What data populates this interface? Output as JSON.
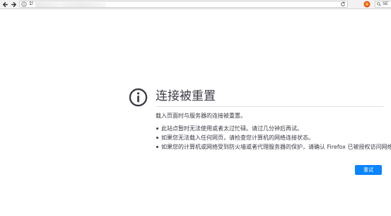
{
  "browser": {
    "url_visible_text": "1!",
    "search_text": "SE",
    "back_icon": "back-arrow-icon",
    "forward_icon": "forward-arrow-icon",
    "reload_icon": "reload-icon",
    "page_info_icon": "info-icon",
    "extension_icon": "extension-icon",
    "search_icon": "search-icon"
  },
  "error": {
    "icon": "info-circle-icon",
    "title": "连接被重置",
    "description": "载入页面时与服务器的连接被重置。",
    "bullets": [
      "此站点暂时无法使用或者太过忙碌。请过几分钟后再试。",
      "如果您无法载入任何网页，请检查您计算机的网络连接状态。",
      "如果您的计算机或网络受到防火墙或者代理服务器的保护，请确认 Firefox 已被授权访问网络。"
    ],
    "retry_label": "重试"
  },
  "colors": {
    "accent": "#0a84ff",
    "text": "#3b3b46",
    "toolbar_bg": "#f2f2f2"
  }
}
